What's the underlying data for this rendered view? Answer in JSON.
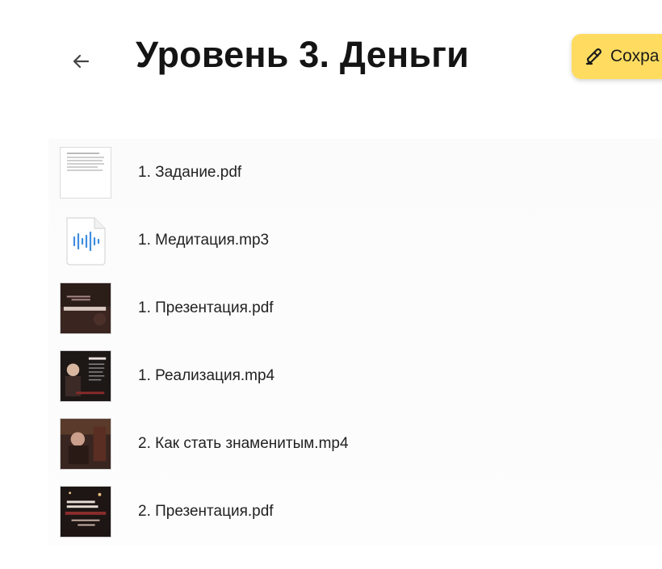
{
  "header": {
    "back_icon": "arrow-left-icon",
    "title": "Уровень 3. Деньги",
    "save_label": "Сохра",
    "save_icon": "pen-icon",
    "accent_color": "#ffdc60"
  },
  "files": [
    {
      "name": "1. Задание.pdf",
      "thumb": "document-page"
    },
    {
      "name": "1. Медитация.mp3",
      "thumb": "audio-file-icon"
    },
    {
      "name": "1. Презентация.pdf",
      "thumb": "presentation-slide"
    },
    {
      "name": "1. Реализация.mp4",
      "thumb": "video-frame"
    },
    {
      "name": "2. Как стать знаменитым.mp4",
      "thumb": "video-frame"
    },
    {
      "name": "2. Презентация.pdf",
      "thumb": "presentation-slide"
    }
  ]
}
